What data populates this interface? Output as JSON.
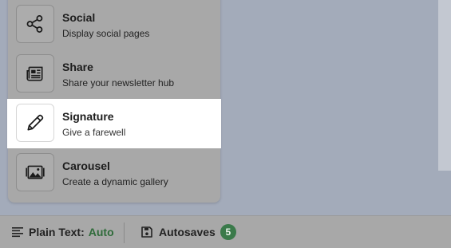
{
  "menu": {
    "items": [
      {
        "title": "Social",
        "subtitle": "Display social pages",
        "icon": "share-nodes-icon"
      },
      {
        "title": "Share",
        "subtitle": "Share your newsletter hub",
        "icon": "newspaper-icon"
      },
      {
        "title": "Signature",
        "subtitle": "Give a farewell",
        "icon": "pencil-icon",
        "highlighted": true
      },
      {
        "title": "Carousel",
        "subtitle": "Create a dynamic gallery",
        "icon": "image-gallery-icon"
      }
    ]
  },
  "statusbar": {
    "plain_text_label": "Plain Text:",
    "plain_text_value": "Auto",
    "autosaves_label": "Autosaves",
    "autosaves_count": "5"
  },
  "colors": {
    "accent_green": "#3a7a4a",
    "overlay": "#a3abba",
    "highlight": "#ffffff"
  }
}
